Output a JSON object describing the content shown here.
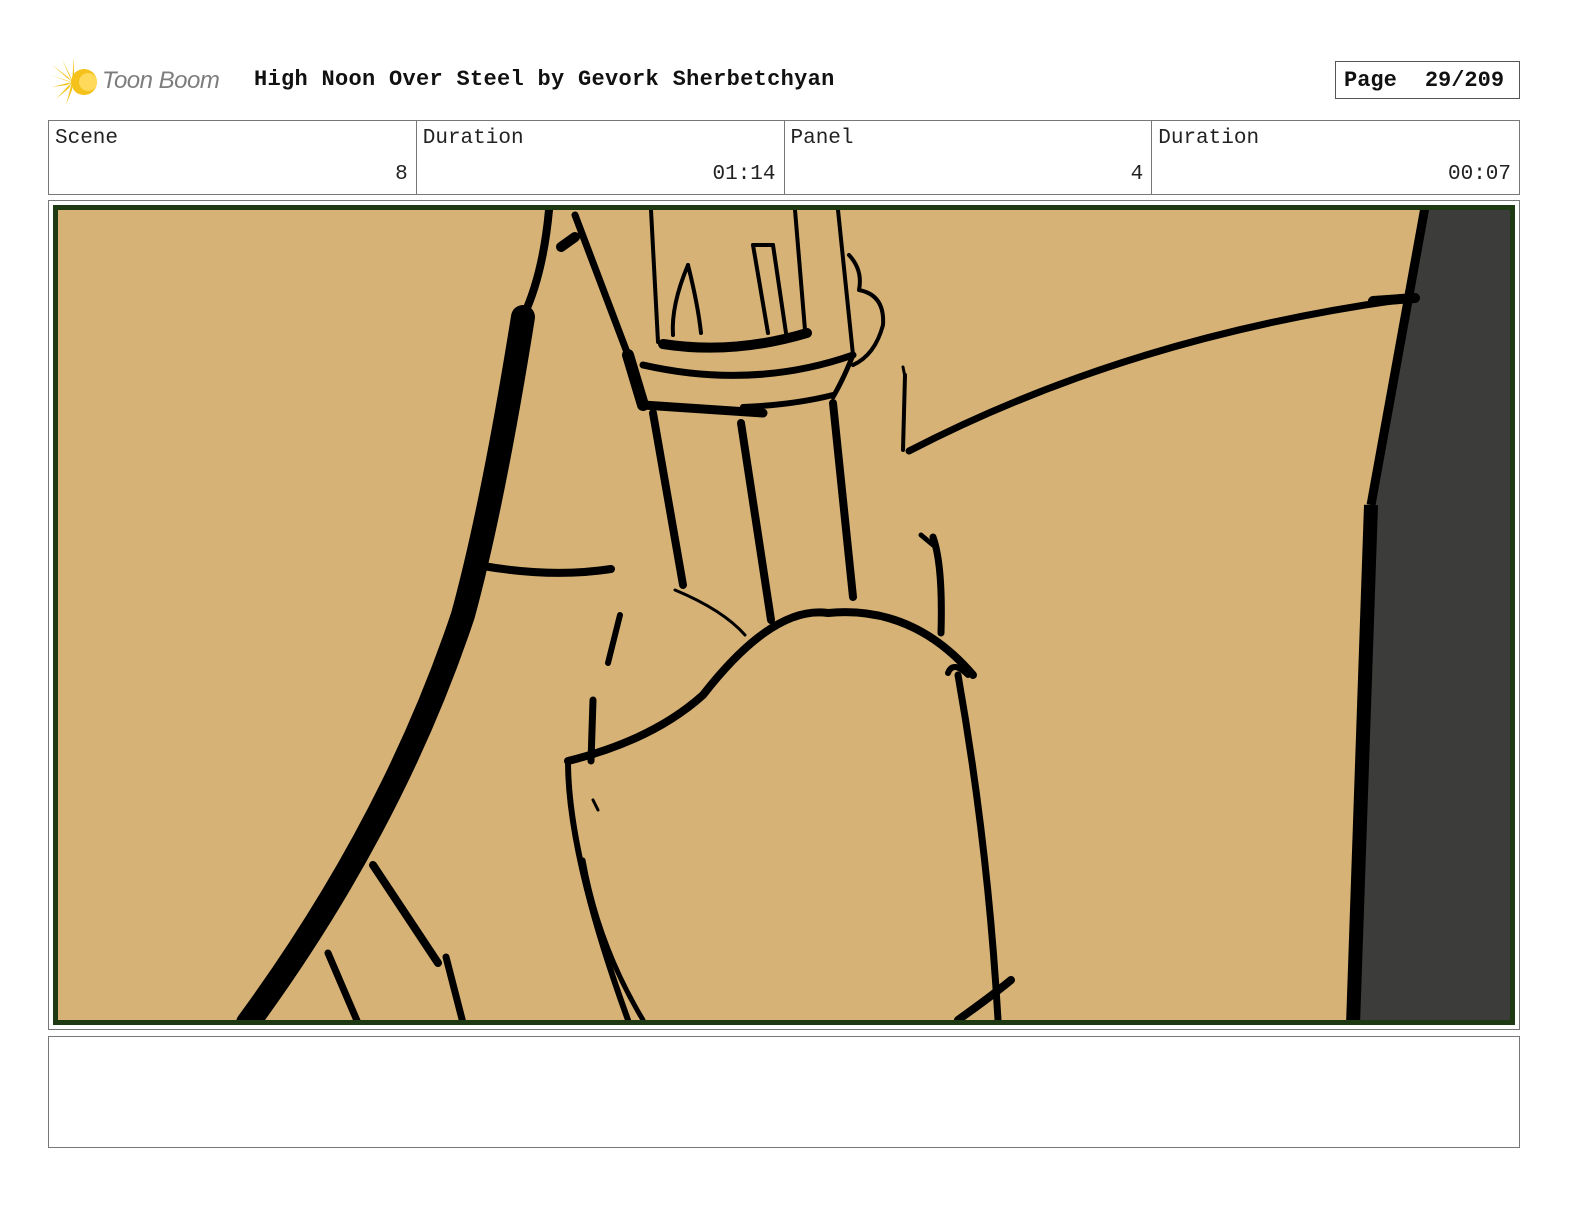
{
  "header": {
    "logo_text": "Toon Boom",
    "title": "High Noon Over Steel by Gevork Sherbetchyan",
    "page_label": "Page",
    "page_value": "29/209"
  },
  "info": {
    "scene_label": "Scene",
    "scene_value": "8",
    "scene_duration_label": "Duration",
    "scene_duration_value": "01:14",
    "panel_label": "Panel",
    "panel_value": "4",
    "panel_duration_label": "Duration",
    "panel_duration_value": "00:07"
  },
  "colors": {
    "panel_fill": "#d6b276",
    "shadow_fill": "#3c3c3b",
    "frame_border": "#1e3a12",
    "ink": "#000000",
    "logo_yellow": "#f4c21a",
    "logo_text": "#7d7d7d"
  },
  "notes": {
    "text": ""
  }
}
